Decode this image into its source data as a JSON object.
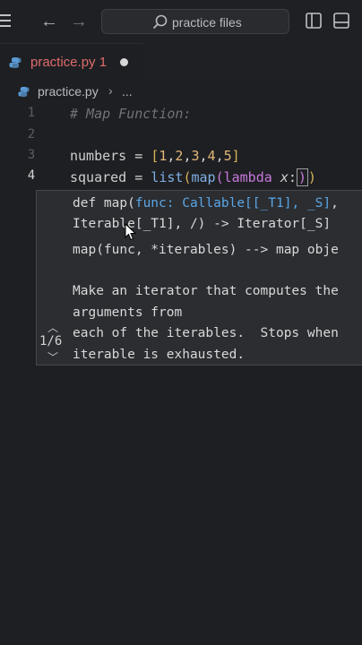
{
  "titlebar": {
    "search_text": "practice files"
  },
  "tab": {
    "file_name": "practice.py",
    "problem_count": "1"
  },
  "breadcrumb": {
    "file": "practice.py",
    "ellipsis": "..."
  },
  "editor": {
    "line_numbers": [
      "1",
      "2",
      "3",
      "4"
    ],
    "line1": "# Map Function:",
    "line3": {
      "name": "numbers",
      "op": " = ",
      "list": [
        "[",
        "1",
        ",",
        "2",
        ",",
        "3",
        ",",
        "4",
        ",",
        "5",
        "]"
      ]
    },
    "line4": {
      "name": "squared",
      "op": " = ",
      "fn1": "list",
      "fn2": "map",
      "kw": "lambda",
      "param": "x",
      "colon": ":"
    }
  },
  "signature_help": {
    "line1_prefix": "def map(",
    "line1_param": "func: Callable[[_T1], _S]",
    "line1_suffix": ",",
    "line2": "Iterable[_T1], /) -> Iterator[_S]",
    "line3": "map(func, *iterables) --> map obje",
    "line4": "Make an iterator that computes the",
    "line5": "arguments from",
    "line6": "each of the iterables.  Stops when",
    "line7": "iterable is exhausted.",
    "counter": "1/6"
  }
}
